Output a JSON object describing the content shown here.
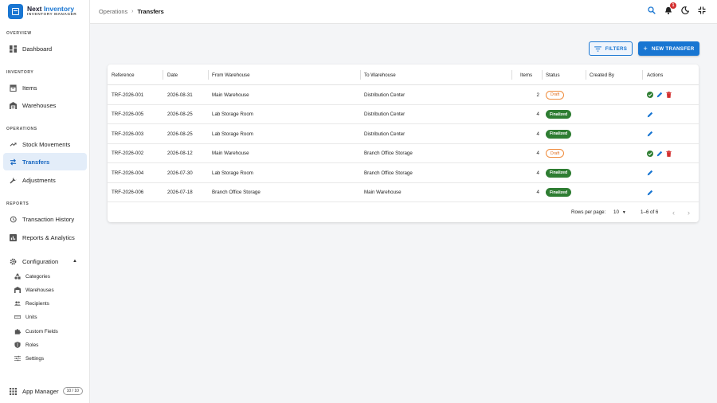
{
  "brand": {
    "name_a": "Next",
    "name_b": "Inventory",
    "subtitle": "INVENTORY MANAGER"
  },
  "sidebar": {
    "sections": {
      "overview": "OVERVIEW",
      "inventory": "INVENTORY",
      "operations": "OPERATIONS",
      "reports": "REPORTS"
    },
    "items": {
      "dashboard": "Dashboard",
      "items": "Items",
      "warehouses": "Warehouses",
      "stock_movements": "Stock Movements",
      "transfers": "Transfers",
      "adjustments": "Adjustments",
      "transaction_history": "Transaction History",
      "reports_analytics": "Reports & Analytics",
      "configuration": "Configuration"
    },
    "config_items": [
      "Categories",
      "Warehouses",
      "Recipients",
      "Units",
      "Custom Fields",
      "Roles",
      "Settings"
    ],
    "app_manager": {
      "label": "App Manager",
      "badge": "10 / 10"
    }
  },
  "topbar": {
    "breadcrumb_parent": "Operations",
    "breadcrumb_separator": "›",
    "breadcrumb_current": "Transfers",
    "notification_count": "1"
  },
  "toolbar": {
    "filters_label": "FILTERS",
    "new_transfer_label": "NEW TRANSFER"
  },
  "table": {
    "headers": {
      "reference": "Reference",
      "date": "Date",
      "from": "From Warehouse",
      "to": "To Warehouse",
      "items": "Items",
      "status": "Status",
      "created_by": "Created By",
      "actions": "Actions"
    },
    "rows": [
      {
        "reference": "TRF-2026-001",
        "date": "2026-08-31",
        "from": "Main Warehouse",
        "to": "Distribution Center",
        "items": "2",
        "status": "Draft",
        "created_by": ""
      },
      {
        "reference": "TRF-2026-005",
        "date": "2026-08-25",
        "from": "Lab Storage Room",
        "to": "Distribution Center",
        "items": "4",
        "status": "Finalized",
        "created_by": ""
      },
      {
        "reference": "TRF-2026-003",
        "date": "2026-08-25",
        "from": "Lab Storage Room",
        "to": "Distribution Center",
        "items": "4",
        "status": "Finalized",
        "created_by": ""
      },
      {
        "reference": "TRF-2026-002",
        "date": "2026-08-12",
        "from": "Main Warehouse",
        "to": "Branch Office Storage",
        "items": "4",
        "status": "Draft",
        "created_by": ""
      },
      {
        "reference": "TRF-2026-004",
        "date": "2026-07-30",
        "from": "Lab Storage Room",
        "to": "Branch Office Storage",
        "items": "4",
        "status": "Finalized",
        "created_by": ""
      },
      {
        "reference": "TRF-2026-006",
        "date": "2026-07-18",
        "from": "Branch Office Storage",
        "to": "Main Warehouse",
        "items": "4",
        "status": "Finalized",
        "created_by": ""
      }
    ],
    "pagination": {
      "rows_per_page_label": "Rows per page:",
      "rows_per_page_value": "10",
      "range": "1–6 of 6"
    }
  },
  "colors": {
    "primary": "#1976d2",
    "finalized": "#2e7d32",
    "draft": "#ef8c3d",
    "delete": "#d32f2f",
    "approve": "#2e7d32"
  }
}
